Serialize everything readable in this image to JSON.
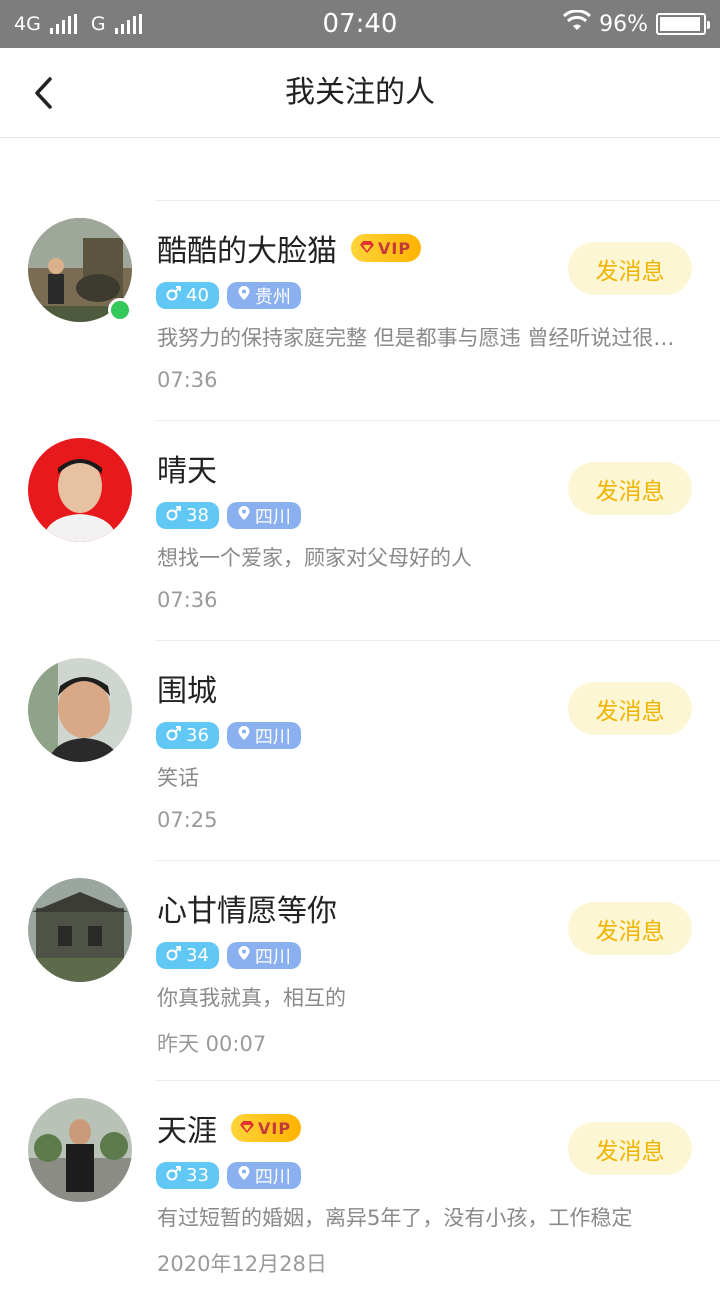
{
  "status_bar": {
    "network_1": "4G",
    "network_2": "G",
    "time": "07:40",
    "battery": "96%",
    "battery_level": 0.96
  },
  "header": {
    "title": "我关注的人",
    "back_icon": "chevron-left-icon"
  },
  "users": [
    {
      "name": "酷酷的大脸猫",
      "vip": true,
      "online": true,
      "age": "40",
      "location": "贵州",
      "bio": "我努力的保持家庭完整 但是都事与愿违 曾经听说过很多故事",
      "time": "07:36",
      "button": "发消息"
    },
    {
      "name": "晴天",
      "vip": false,
      "online": false,
      "age": "38",
      "location": "四川",
      "bio": "想找一个爱家，顾家对父母好的人",
      "time": "07:36",
      "button": "发消息"
    },
    {
      "name": "围城",
      "vip": false,
      "online": false,
      "age": "36",
      "location": "四川",
      "bio": "笑话",
      "time": "07:25",
      "button": "发消息"
    },
    {
      "name": "心甘情愿等你",
      "vip": false,
      "online": false,
      "age": "34",
      "location": "四川",
      "bio": "你真我就真，相互的",
      "time": "昨天 00:07",
      "button": "发消息"
    },
    {
      "name": "天涯",
      "vip": true,
      "online": false,
      "age": "33",
      "location": "四川",
      "bio": "有过短暂的婚姻，离异5年了，没有小孩，工作稳定",
      "time": "2020年12月28日",
      "button": "发消息"
    }
  ],
  "vip_label": "VIP",
  "colors": {
    "accent": "#f0b400",
    "button_bg": "#fdf6d4",
    "age_tag": "#61c8f5",
    "location_tag": "#8ab0ef",
    "online": "#34c759"
  }
}
